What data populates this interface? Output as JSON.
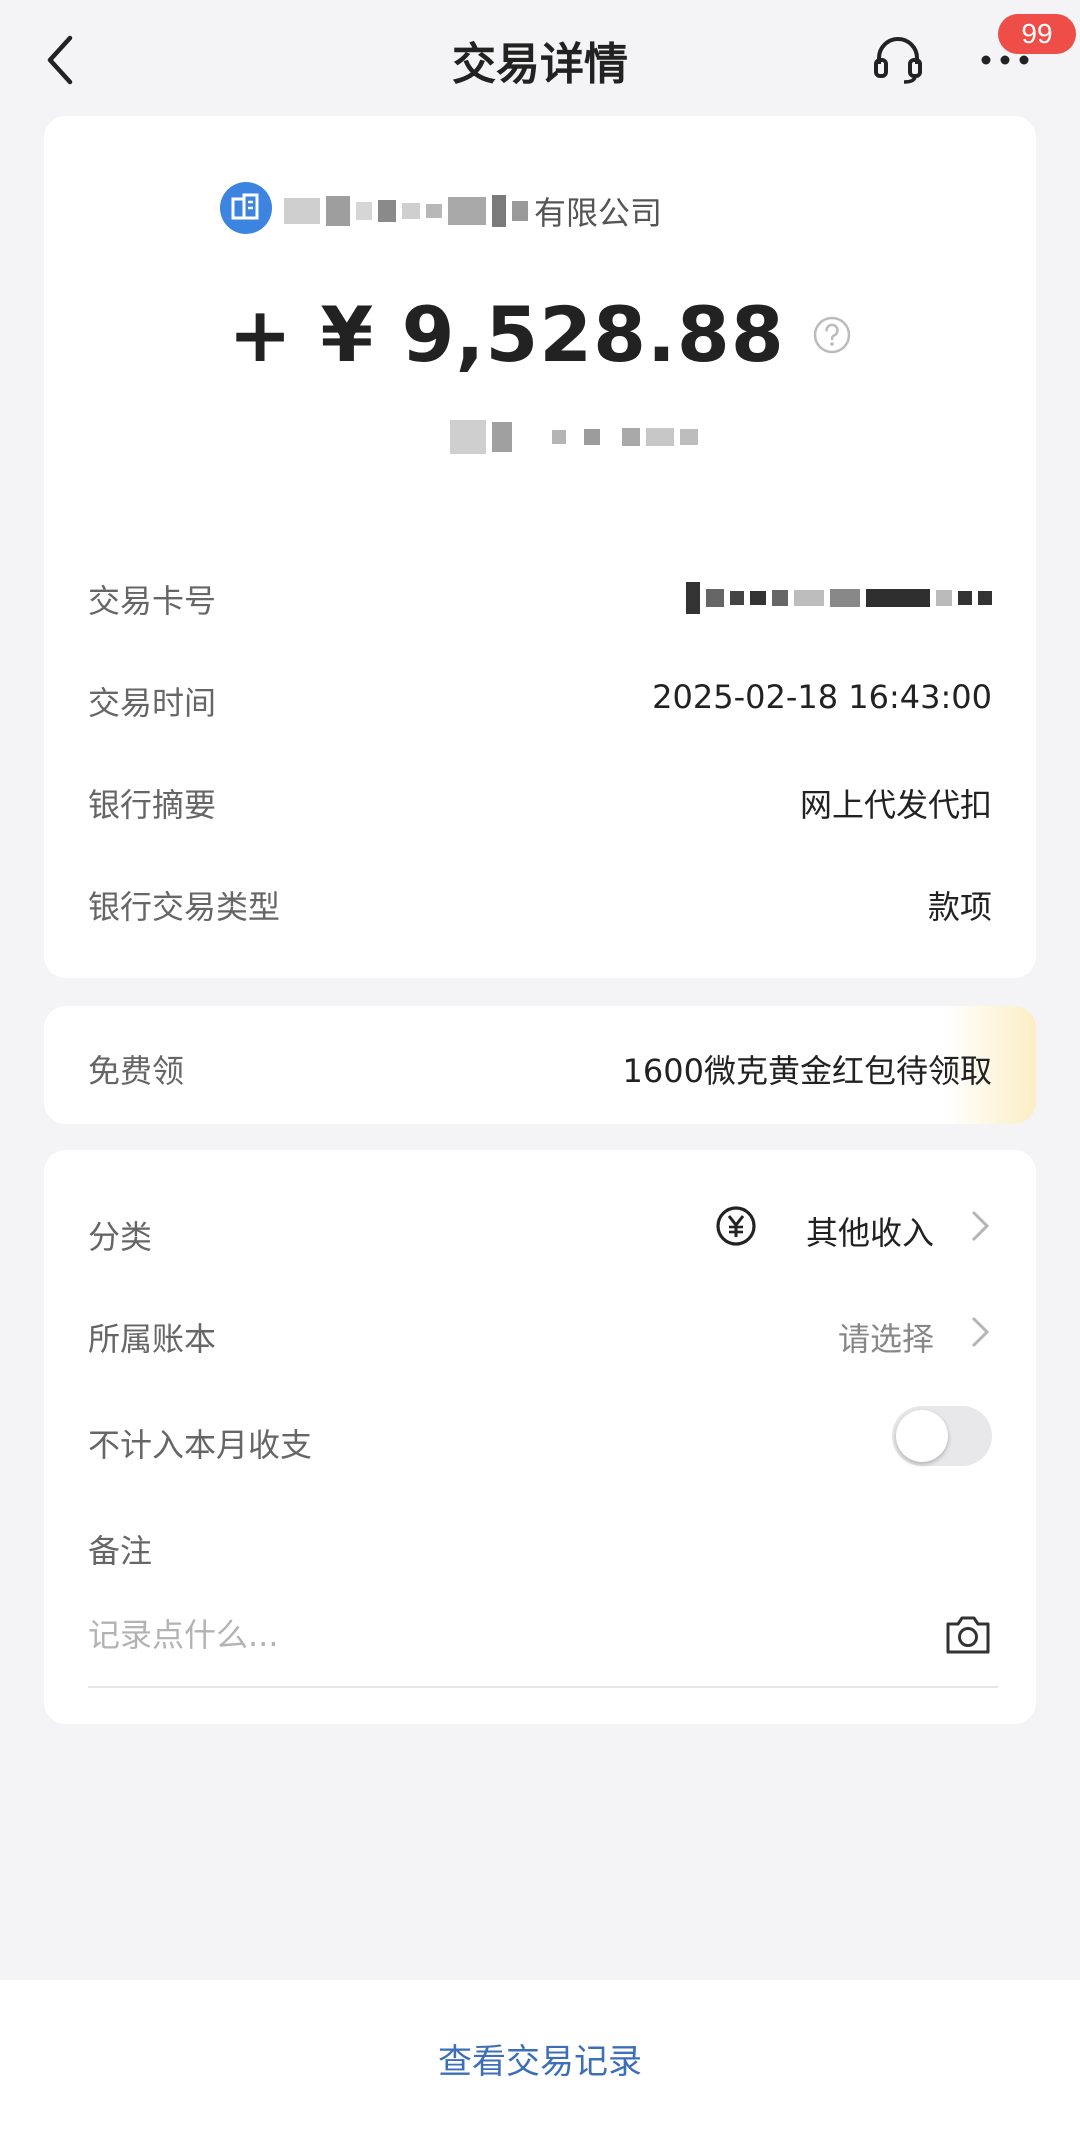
{
  "header": {
    "title": "交易详情",
    "badge_count": "99",
    "icons": [
      "back-arrow-icon",
      "headset-icon",
      "more-icon"
    ]
  },
  "transaction": {
    "merchant_suffix": "有限公司",
    "amount": "+ ¥ 9,528.88",
    "details": [
      {
        "label": "交易卡号",
        "value": ""
      },
      {
        "label": "交易时间",
        "value": "2025-02-18 16:43:00"
      },
      {
        "label": "银行摘要",
        "value": "网上代发代扣"
      },
      {
        "label": "银行交易类型",
        "value": "款项"
      }
    ]
  },
  "promo": {
    "label": "免费领",
    "value": "1600微克黄金红包待领取"
  },
  "settings": {
    "category_label": "分类",
    "category_value": "其他收入",
    "ledger_label": "所属账本",
    "ledger_value": "请选择",
    "exclude_label": "不计入本月收支",
    "exclude_on": false,
    "note_label": "备注",
    "note_placeholder": "记录点什么..."
  },
  "footer": {
    "history_link": "查看交易记录"
  },
  "colors": {
    "accent_link": "#3d6fb6",
    "badge": "#ee4d48",
    "merchant_icon": "#3d84e0"
  }
}
